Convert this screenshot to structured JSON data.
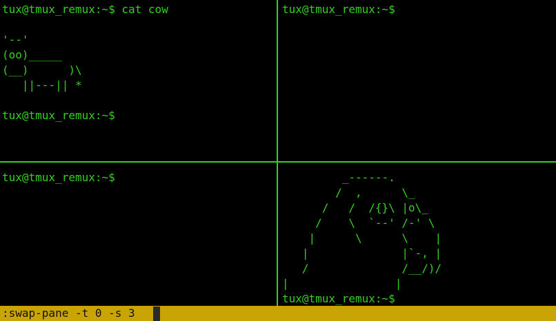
{
  "theme": {
    "foreground": "#33d11d",
    "background": "#000000",
    "status_bar": "#c9a405",
    "status_text": "#111111"
  },
  "panes": [
    {
      "lines": [
        "tux@tmux_remux:~$ cat cow",
        "",
        "'--'",
        "(oo)_____",
        "(__)      )\\",
        "   ||---|| *",
        "",
        "tux@tmux_remux:~$"
      ]
    },
    {
      "lines": [
        "tux@tmux_remux:~$"
      ]
    },
    {
      "lines": [
        "tux@tmux_remux:~$"
      ]
    },
    {
      "lines": [
        "         _------.",
        "        /  ,      \\_",
        "      /   /  /{}\\ |o\\_",
        "     /    \\  `--' /-' \\",
        "    |      \\      \\    |",
        "   |              |`-, |",
        "   /              /__/)/",
        "|                |",
        "tux@tmux_remux:~$"
      ]
    }
  ],
  "command_line": {
    "text": ":swap-pane -t 0 -s 3"
  }
}
